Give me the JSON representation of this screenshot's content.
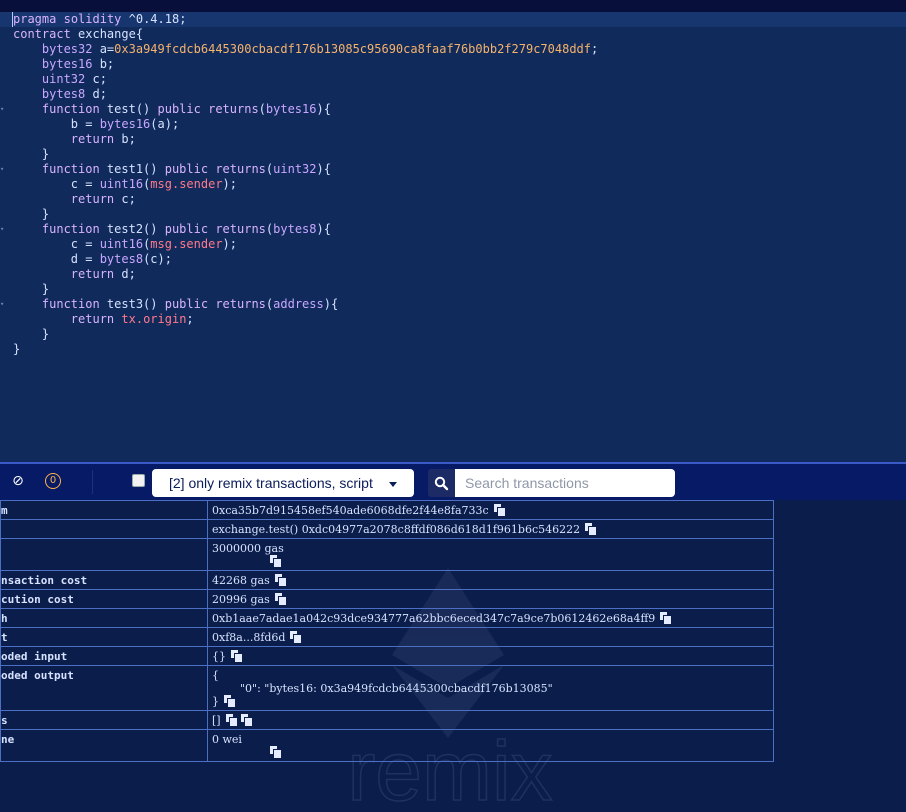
{
  "editor": {
    "lines": [
      {
        "fold": "",
        "html": "<span class='kw'>pragma</span> <span class='kw'>solidity</span> ^0.4.18;"
      },
      {
        "fold": "",
        "html": "<span class='kw'>contract</span> exchange{"
      },
      {
        "fold": "",
        "html": "    <span class='ty'>bytes32</span> a=<span class='num'>0x3a949fcdcb6445300cbacdf176b13085c95690ca8faaf76b0bb2f279c7048ddf</span>;"
      },
      {
        "fold": "",
        "html": "    <span class='ty'>bytes16</span> b;"
      },
      {
        "fold": "",
        "html": "    <span class='ty'>uint32</span> c;"
      },
      {
        "fold": "",
        "html": "    <span class='ty'>bytes8</span> d;"
      },
      {
        "fold": "▾",
        "html": "    <span class='kw'>function</span> test() <span class='kw'>public</span> <span class='kw'>returns</span>(<span class='ty'>bytes16</span>){"
      },
      {
        "fold": "",
        "html": "        b = <span class='ty'>bytes16</span>(a);"
      },
      {
        "fold": "",
        "html": "        <span class='kw'>return</span> b;"
      },
      {
        "fold": "",
        "html": "    }"
      },
      {
        "fold": "▾",
        "html": "    <span class='kw'>function</span> test1() <span class='kw'>public</span> <span class='kw'>returns</span>(<span class='ty'>uint32</span>){"
      },
      {
        "fold": "",
        "html": "        c = <span class='ty'>uint16</span>(<span class='glob'>msg.sender</span>);"
      },
      {
        "fold": "",
        "html": "        <span class='kw'>return</span> c;"
      },
      {
        "fold": "",
        "html": "    }"
      },
      {
        "fold": "▾",
        "html": "    <span class='kw'>function</span> test2() <span class='kw'>public</span> <span class='kw'>returns</span>(<span class='ty'>bytes8</span>){"
      },
      {
        "fold": "",
        "html": "        c = <span class='ty'>uint16</span>(<span class='glob'>msg.sender</span>);"
      },
      {
        "fold": "",
        "html": "        d = <span class='ty'>bytes8</span>(c);"
      },
      {
        "fold": "",
        "html": "        <span class='kw'>return</span> d;"
      },
      {
        "fold": "",
        "html": "    }"
      },
      {
        "fold": "▾",
        "html": "    <span class='kw'>function</span> test3() <span class='kw'>public</span> <span class='kw'>returns</span>(<span class='ty'>address</span>){"
      },
      {
        "fold": "",
        "html": "        <span class='kw'>return</span> <span class='glob'>tx.origin</span>;"
      },
      {
        "fold": "",
        "html": "    }"
      },
      {
        "fold": "",
        "html": "}"
      }
    ]
  },
  "toolbar": {
    "pending_count": "0",
    "filter_label": "[2] only remix transactions, script",
    "search_placeholder": "Search transactions"
  },
  "transaction": {
    "rows": [
      {
        "key": "m",
        "value": "0xca35b7d915458ef540ade6068dfe2f44e8fa733c",
        "copy": 1,
        "icon_below": false
      },
      {
        "key": "",
        "value": "exchange.test() 0xdc04977a2078c8ffdf086d618d1f961b6c546222",
        "copy": 1,
        "icon_below": false
      },
      {
        "key": "",
        "value": "3000000 gas",
        "copy": 1,
        "icon_below": true
      },
      {
        "key": "nsaction cost",
        "value": "42268 gas",
        "copy": 1,
        "icon_below": false
      },
      {
        "key": "cution cost",
        "value": "20996 gas",
        "copy": 1,
        "icon_below": false
      },
      {
        "key": "h",
        "value": "0xb1aae7adae1a042c93dce934777a62bbc6eced347c7a9ce7b0612462e68a4ff9",
        "copy": 1,
        "icon_below": false
      },
      {
        "key": "t",
        "value": "0xf8a...8fd6d",
        "copy": 1,
        "icon_below": false
      },
      {
        "key": "oded input",
        "value": "{}",
        "copy": 1,
        "icon_below": false
      },
      {
        "key": "oded output",
        "value": "{\n\t\"0\": \"bytes16: 0x3a949fcdcb6445300cbacdf176b13085\"\n}",
        "copy": 1,
        "icon_below": false
      },
      {
        "key": "s",
        "value": "[]",
        "copy": 2,
        "icon_below": false
      },
      {
        "key": "ne",
        "value": "0 wei",
        "copy": 1,
        "icon_below": true
      }
    ]
  },
  "watermark": {
    "text": "remix"
  }
}
